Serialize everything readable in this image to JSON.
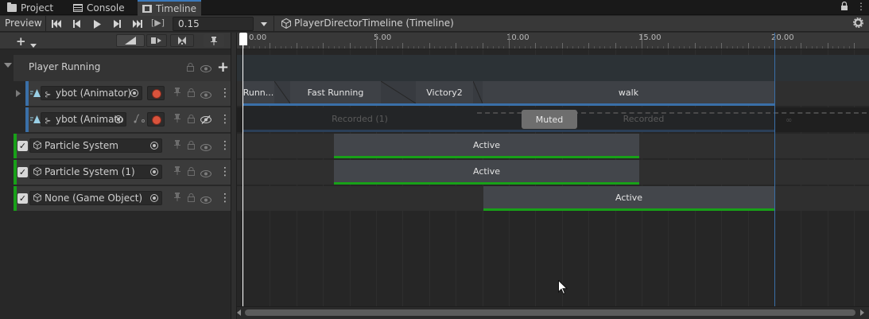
{
  "tabs": [
    {
      "label": "Project",
      "icon": "folder-icon"
    },
    {
      "label": "Console",
      "icon": "console-icon"
    },
    {
      "label": "Timeline",
      "icon": "film-icon",
      "active": true
    }
  ],
  "toolbar": {
    "preview_label": "Preview",
    "frame_value": "0.15",
    "director_label": "PlayerDirectorTimeline (Timeline)",
    "frame_mode_label": "[▶]"
  },
  "ruler": {
    "ticks": [
      "0.00",
      "5.00",
      "10.00",
      "15.00",
      "20.00"
    ]
  },
  "group": {
    "title": "Player Running"
  },
  "tracks": {
    "animator1": {
      "label": "ybot (Animator)"
    },
    "animator2": {
      "label": "ybot (Animato"
    },
    "particle1": {
      "label": "Particle System"
    },
    "particle2": {
      "label": "Particle System (1)"
    },
    "none": {
      "label": "None (Game Object)"
    }
  },
  "clips": {
    "anim1": [
      "Runn...",
      "Fast Running",
      "Victory2",
      "walk"
    ],
    "recorded": [
      "Recorded (1)",
      "Recorded"
    ],
    "muted": "Muted",
    "active": "Active"
  },
  "colors": {
    "accent": "#3a79bb",
    "active_green": "#18a018",
    "record_red": "#d9533c"
  }
}
